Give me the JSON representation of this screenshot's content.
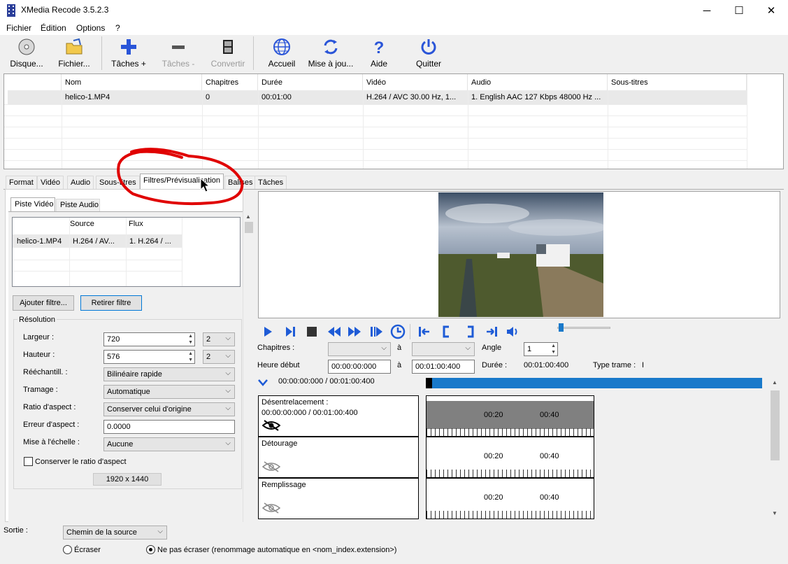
{
  "window": {
    "title": "XMedia Recode 3.5.2.3",
    "minimize": "─",
    "maximize": "☐",
    "close": "✕"
  },
  "menu": [
    "Fichier",
    "Édition",
    "Options",
    "?"
  ],
  "toolbar": {
    "disque": "Disque...",
    "fichier": "Fichier...",
    "taches_add": "Tâches +",
    "taches_rem": "Tâches -",
    "convertir": "Convertir",
    "accueil": "Accueil",
    "mise": "Mise à jou...",
    "aide": "Aide",
    "quitter": "Quitter"
  },
  "filelist": {
    "headers": [
      "Nom",
      "Chapitres",
      "Durée",
      "Vidéo",
      "Audio",
      "Sous-titres"
    ],
    "row": [
      "helico-1.MP4",
      "0",
      "00:01:00",
      "H.264 / AVC  30.00 Hz, 1...",
      "1. English AAC  127 Kbps 48000 Hz ...",
      ""
    ]
  },
  "tabs": [
    "Format",
    "Vidéo",
    "Audio",
    "Sous-titres",
    "Filtres/Prévisualisation",
    "Balises",
    "Tâches"
  ],
  "subtabs": [
    "Piste Vidéo",
    "Piste Audio"
  ],
  "tracks": {
    "headers": [
      "Source",
      "Flux"
    ],
    "row": [
      "helico-1.MP4",
      "H.264 / AV...",
      "1. H.264 / ..."
    ]
  },
  "buttons": {
    "add_filter": "Ajouter filtre...",
    "remove_filter": "Retirer filtre"
  },
  "resolution": {
    "group": "Résolution",
    "largeur_label": "Largeur :",
    "largeur": "720",
    "largeur_div": "2",
    "hauteur_label": "Hauteur :",
    "hauteur": "576",
    "hauteur_div": "2",
    "reech_label": "Rééchantill. :",
    "reech": "Bilinéaire rapide",
    "tramage_label": "Tramage :",
    "tramage": "Automatique",
    "ratio_label": "Ratio d'aspect :",
    "ratio": "Conserver celui d'origine",
    "erreur_label": "Erreur d'aspect :",
    "erreur": "0.0000",
    "mise_label": "Mise à l'échelle :",
    "mise": "Aucune",
    "conserver": "Conserver le ratio d'aspect",
    "source_res": "1920 x 1440"
  },
  "preview": {
    "chapitres_label": "Chapitres :",
    "a1": "à",
    "angle_label": "Angle",
    "angle": "1",
    "heure_label": "Heure début",
    "heure_debut": "00:00:00:000",
    "a2": "à",
    "heure_fin": "00:01:00:400",
    "duree_label": "Durée :",
    "duree": "00:01:00:400",
    "type_label": "Type trame :",
    "type": "I",
    "position": "00:00:00:000 / 00:01:00:400"
  },
  "filters": [
    {
      "name": "Désentrelacement :",
      "time": "00:00:00:000 / 00:01:00:400",
      "t1": "00:20",
      "t2": "00:40"
    },
    {
      "name": "Détourage",
      "time": "",
      "t1": "00:20",
      "t2": "00:40"
    },
    {
      "name": "Remplissage",
      "time": "",
      "t1": "00:20",
      "t2": "00:40"
    }
  ],
  "output": {
    "label": "Sortie :",
    "dest": "Chemin de la source",
    "ecraser": "Écraser",
    "ne_pas": "Ne pas écraser (renommage automatique en <nom_index.extension>)"
  },
  "colors": {
    "accent": "#1979ca",
    "annotation": "#e00000",
    "icon_blue": "#2a55d8"
  }
}
